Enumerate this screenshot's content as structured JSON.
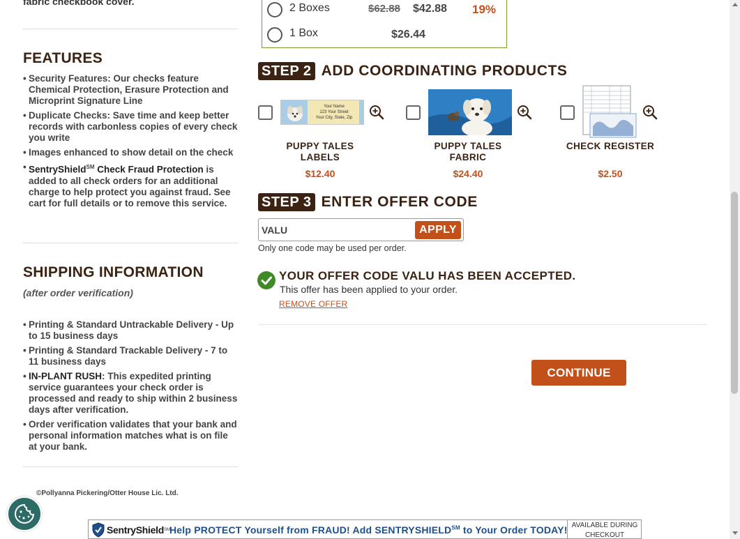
{
  "left": {
    "intro_tail": "fabric checkbook cover.",
    "features_title": "FEATURES",
    "features": [
      "Security Features: Our checks feature Chemical Protection, Erasure Protection and Microprint Signature Line",
      "Duplicate Checks: Save time and keep better records with carbonless copies of every check you write",
      "Images enhanced to show detail on the check"
    ],
    "sentry_feature": {
      "name": "SentryShield",
      "mark": "SM",
      "title_tail": " Check Fraud Protection",
      "body": " is added to all check orders for an additional charge to help protect you against fraud. See cart for full details or to remove this service."
    },
    "shipping_title": "SHIPPING INFORMATION",
    "shipping_sub": "(after order verification)",
    "shipping": [
      "Printing & Standard Untrackable Delivery - Up to 15 business days",
      "Printing & Standard Trackable Delivery - 7 to 11 business days"
    ],
    "rush": {
      "label": "IN-PLANT RUSH",
      "body": ": This expedited printing service guarantees your check order is processed and ready to ship within 2 business days after verification."
    },
    "verification": "Order verification validates that your bank and personal information matches what is on file at your bank.",
    "copyright": "©Pollyanna Pickering/Otter House Lic. Ltd."
  },
  "quantity": {
    "options": [
      {
        "label": "2 Boxes",
        "old_price": "$62.88",
        "price": "$42.88",
        "savings": "19%"
      },
      {
        "label": "1 Box",
        "old_price": "",
        "price": "$26.44",
        "savings": ""
      }
    ]
  },
  "step2": {
    "badge": "STEP 2",
    "title": "ADD COORDINATING PRODUCTS",
    "products": [
      {
        "name": "PUPPY TALES LABELS",
        "price": "$12.40",
        "icon": "zoom-in-icon"
      },
      {
        "name": "PUPPY TALES FABRIC",
        "price": "$24.40",
        "icon": "zoom-in-icon"
      },
      {
        "name": "CHECK REGISTER",
        "price": "$2.50",
        "icon": "zoom-in-icon"
      }
    ],
    "label_thumb": {
      "line1": "Your Name",
      "line2": "123 Your Street",
      "line3": "Your City, State, Zip"
    }
  },
  "step3": {
    "badge": "STEP 3",
    "title": "ENTER OFFER CODE",
    "code_value": "VALU",
    "apply_label": "APPLY",
    "note": "Only one code may be used per order.",
    "accepted_title": "YOUR OFFER CODE VALU HAS BEEN ACCEPTED.",
    "accepted_sub": "This offer has been applied to your order.",
    "remove_label": "REMOVE OFFER"
  },
  "continue_label": "CONTINUE",
  "banner": {
    "logo_name": "SentryShield",
    "logo_mark": "SM",
    "text": "Help PROTECT Yourself from FRAUD! Add SENTRYSHIELD",
    "text_mark": "SM",
    "text_tail": " to Your Order TODAY!",
    "right_line1": "AVAILABLE DURING",
    "right_line2": "CHECKOUT"
  },
  "colors": {
    "brown": "#3c2212",
    "orange": "#c1501a",
    "green": "#3f8a26",
    "banner_blue": "#1e4f8a"
  }
}
